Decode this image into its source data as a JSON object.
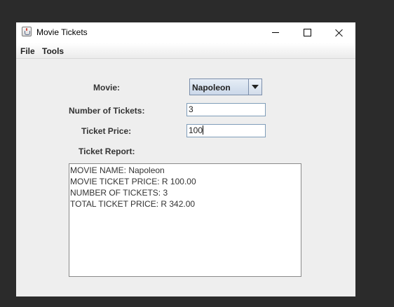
{
  "window": {
    "title": "Movie Tickets"
  },
  "menu": {
    "file": "File",
    "tools": "Tools"
  },
  "form": {
    "movie_label": "Movie:",
    "movie_selected": "Napoleon",
    "num_tickets_label": "Number of Tickets:",
    "num_tickets_value": "3",
    "ticket_price_label": "Ticket Price:",
    "ticket_price_value": "100",
    "report_label": "Ticket Report:"
  },
  "report": {
    "lines": [
      "MOVIE NAME: Napoleon",
      "MOVIE TICKET PRICE: R 100.00",
      "NUMBER OF TICKETS: 3",
      "TOTAL TICKET PRICE: R 342.00"
    ]
  },
  "icons": {
    "app": "java-cup-icon",
    "minimize": "minimize-icon",
    "maximize": "maximize-icon",
    "close": "close-icon",
    "dropdown": "chevron-down-icon"
  }
}
